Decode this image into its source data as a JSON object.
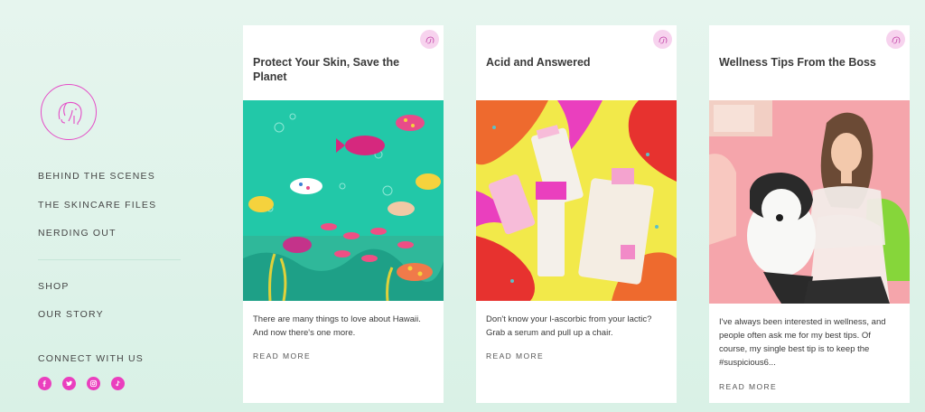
{
  "sidebar": {
    "logo_icon": "elephant-logo",
    "nav": [
      {
        "label": "BEHIND THE SCENES"
      },
      {
        "label": "THE SKINCARE FILES"
      },
      {
        "label": "NERDING OUT"
      }
    ],
    "links": [
      {
        "label": "SHOP"
      },
      {
        "label": "OUR STORY"
      }
    ],
    "connect_label": "CONNECT WITH US",
    "social": [
      "facebook-icon",
      "twitter-icon",
      "instagram-icon",
      "tiktok-icon"
    ]
  },
  "cards": [
    {
      "title": "Protect Your Skin, Save the Planet",
      "excerpt": "There are many things to love about Hawaii. And now there's one more.",
      "read_more": "READ MORE",
      "image": "underwater-fish-illustration"
    },
    {
      "title": "Acid and Answered",
      "excerpt": "Don't know your l-ascorbic from your lactic? Grab a serum and pull up a chair.",
      "read_more": "READ MORE",
      "image": "skincare-products-illustration"
    },
    {
      "title": "Wellness Tips From the Boss",
      "excerpt": "I've always been interested in wellness, and people often ask me for my best tips. Of course, my single best tip is to keep the #suspicious6...",
      "read_more": "READ MORE",
      "image": "woman-with-dog-illustration"
    }
  ],
  "colors": {
    "accent": "#ea3fbe",
    "background": "#dff3ea"
  }
}
